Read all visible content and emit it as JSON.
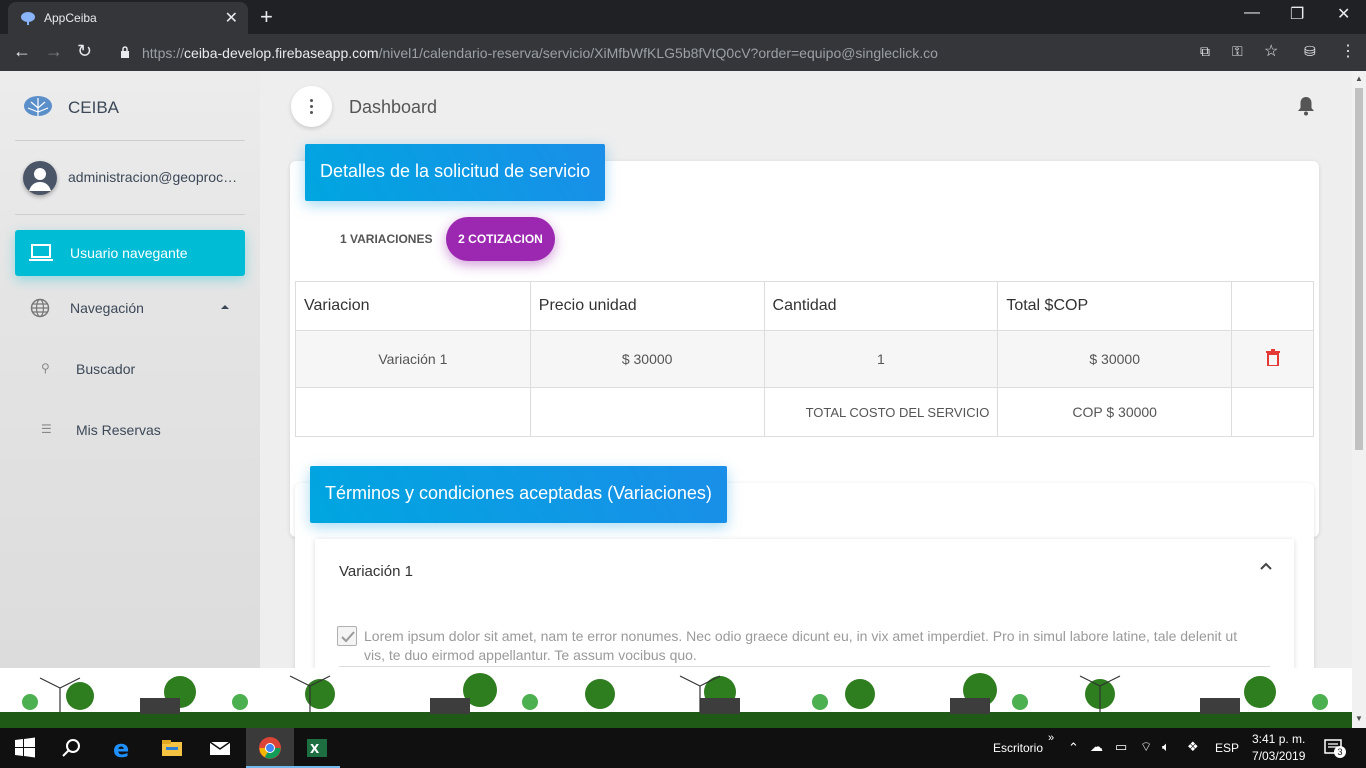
{
  "browser": {
    "tab_title": "AppCeiba",
    "url_scheme": "https://",
    "url_host": "ceiba-develop.firebaseapp.com",
    "url_path": "/nivel1/calendario-reserva/servicio/XiMfbWfKLG5b8fVtQ0cV?order=equipo@singleclick.co"
  },
  "sidebar": {
    "brand": "CEIBA",
    "user_email": "administracion@geoprocesos.com",
    "items": [
      {
        "label": "Usuario navegante",
        "icon": "laptop-icon",
        "active": true
      },
      {
        "label": "Navegación",
        "icon": "globe-icon"
      },
      {
        "label": "Buscador",
        "icon": "search-icon"
      },
      {
        "label": "Mis Reservas",
        "icon": "list-icon"
      }
    ]
  },
  "topbar": {
    "breadcrumb": "Dashboard"
  },
  "details_card": {
    "header": "Detalles de la solicitud de servicio",
    "tabs": [
      "1 VARIACIONES",
      "2 COTIZACION"
    ],
    "active_tab": 1,
    "table": {
      "columns": [
        "Variacion",
        "Precio unidad",
        "Cantidad",
        "Total $COP",
        ""
      ],
      "rows": [
        {
          "variacion": "Variación 1",
          "precio": "$ 30000",
          "cantidad": "1",
          "total": "$ 30000"
        }
      ],
      "summary_label": "TOTAL COSTO DEL SERVICIO",
      "summary_value": "COP $ 30000"
    }
  },
  "terms_card": {
    "header": "Términos y condiciones aceptadas (Variaciones)",
    "panel_title": "Variación 1",
    "terms_text": "Lorem ipsum dolor sit amet, nam te error nonumes. Nec odio graece dicunt eu, in vix amet imperdiet. Pro in simul labore latine, tale delenit ut vis, te duo eirmod appellantur. Te assum vocibus quo.",
    "accepted": true
  },
  "taskbar": {
    "desktop_label": "Escritorio",
    "lang": "ESP",
    "time": "3:41 p. m.",
    "date": "7/03/2019",
    "notifications": "3"
  },
  "colors": {
    "accent": "#00bcd4",
    "tab_active": "#9c27b0",
    "header_blue": "#00a6e0",
    "delete": "#e53935"
  }
}
